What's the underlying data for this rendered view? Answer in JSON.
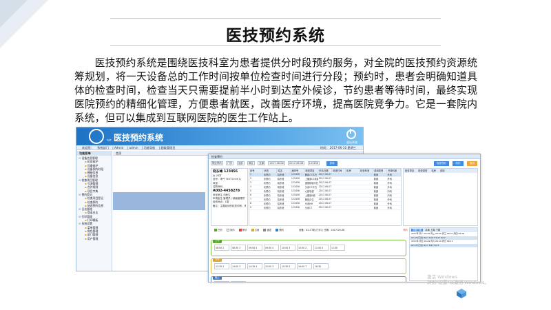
{
  "slide": {
    "title": "医技预约系统",
    "intro": "医技预约系统是围绕医技科室为患者提供分时段预约服务，对全院的医技预约资源统筹规划，将一天设备总的工作时间按单位检查时间进行分段；预约时，患者会明确知道具体的检查时间，检查当天只需要提前半小时到达室外候诊，节约患者等待时间，最终实现医院预约的精细化管理，方便患者就医，改善医疗环境，提高医院竞争力。它是一套院内系统，但可以集成到互联网医院的医生工作站上。"
  },
  "app_window": {
    "title": "医技预约系统",
    "logo_sub": "hdt",
    "exit_label": "退出系统",
    "status_bar": [
      "欢迎您：",
      "系统部门",
      "| Admin",
      "| admin",
      "| 功能导航",
      "| 超级管理员"
    ],
    "time": "时间： 2017-06-10 星期三",
    "sidebar_title": "功能菜单",
    "tab_label": "首页",
    "tree": [
      {
        "type": "grp",
        "label": "设备信息管理"
      },
      {
        "type": "sub",
        "label": "机房维护"
      },
      {
        "type": "sub",
        "label": "设备维护"
      },
      {
        "type": "sub",
        "label": "设备预约时段"
      },
      {
        "type": "sub",
        "label": "模板信息"
      },
      {
        "type": "sub",
        "label": "设备信息"
      },
      {
        "type": "grp",
        "label": "检查项目管理"
      },
      {
        "type": "sub",
        "label": "号源管理"
      },
      {
        "type": "sub",
        "label": "合并规则"
      },
      {
        "type": "sub",
        "label": "项目字典"
      },
      {
        "type": "grp",
        "label": "预约登记"
      },
      {
        "type": "sub",
        "label": "检查项目登记"
      },
      {
        "type": "sub",
        "label": "检查预约"
      },
      {
        "type": "sub",
        "label": "修改预约信息"
      },
      {
        "type": "grp",
        "label": "日志管理"
      },
      {
        "type": "sub",
        "label": "登录日志"
      },
      {
        "type": "grp",
        "label": "打印管理"
      },
      {
        "type": "sub",
        "label": "打印模板"
      },
      {
        "type": "grp",
        "label": "系统设置"
      },
      {
        "type": "sub",
        "label": "菜单管理"
      },
      {
        "type": "sub",
        "label": "角色管理"
      },
      {
        "type": "sub",
        "label": "部门管理"
      },
      {
        "type": "sub",
        "label": "用户管理"
      }
    ]
  },
  "booking_window": {
    "title": "检查预约",
    "toolbar": {
      "field1": "院区预约",
      "field2": "门诊",
      "field3": "全部",
      "field4": "病区",
      "field5": "全部",
      "date_from": "2017-06-08",
      "date_to": "2017-06-08",
      "query_value": "123456",
      "search_btn": "查询",
      "btn_check": "检查预约",
      "btn_modify": "改约",
      "btn_cancel": "取消"
    },
    "patient": {
      "name": "晓东峰 123456",
      "sex": "女 28岁",
      "sub": "挂号：李丹 TEST2019(1)",
      "dept_lbl": "科室：",
      "card_lbl": "住院号码",
      "card": "A002-4458278",
      "l1": "科室医生 刘医生",
      "l2": "申请医生 管理员 / 超级管理员",
      "l3": "检查地点：1楼",
      "l4": "备注：主要症状的检查诊断，请到门诊医疗检查室候诊"
    },
    "table_headers": [
      "序号",
      "状态",
      "姓名",
      "病历号",
      "检查项目",
      "申请日期",
      "检查时间",
      "机房",
      "检查科室",
      "费用类别",
      "开单科室"
    ],
    "rows": [
      [
        "1",
        "未预约",
        "晓东峰",
        "123456",
        "胸部CT平扫",
        "2017-06-07 15:46",
        "",
        "",
        "",
        "普通",
        "外科"
      ],
      [
        "2",
        "未预约",
        "晓东峰",
        "123456",
        "上腹部CT增强",
        "2017-06-07 15:46",
        "",
        "",
        "",
        "普通",
        "外科"
      ],
      [
        "3",
        "未预约",
        "晓东峰",
        "123456",
        "颈椎核磁平扫",
        "2017-06-07 15:46",
        "",
        "",
        "",
        "普通",
        "外科"
      ],
      [
        "4",
        "未预约",
        "晓东峰",
        "123456",
        "头颅CT平扫",
        "2017-06-07 15:46",
        "",
        "",
        "",
        "普通",
        "外科"
      ],
      [
        "5",
        "未预约",
        "晓东峰",
        "123456",
        "心脏彩超",
        "2017-06-07 15:46",
        "",
        "",
        "",
        "普通",
        "内科"
      ],
      [
        "6",
        "未预约",
        "晓东峰",
        "123456",
        "上腹部B超",
        "2017-06-07 15:46",
        "",
        "",
        "",
        "普通",
        "内科"
      ],
      [
        "7",
        "未预约",
        "晓东峰",
        "123456",
        "胸部正位",
        "2017-06-07 15:46",
        "",
        "",
        "",
        "普通",
        "外科"
      ],
      [
        "8",
        "未预约",
        "晓东峰",
        "123456",
        "头颅MR",
        "2017-06-07 15:46",
        "",
        "",
        "",
        "普通",
        "外科"
      ],
      [
        "9",
        "未预约",
        "晓东峰",
        "123456",
        "头颅CT",
        "2017-06-07 15:46",
        "",
        "",
        "",
        "普通",
        "外科"
      ]
    ],
    "right_headers": [
      "检查项目",
      "检查类型",
      "机房",
      "费用"
    ],
    "slot_legend": [
      "已约",
      "未约",
      "停诊",
      "占用",
      "锁定",
      "预约"
    ],
    "slot_title": "设备：02-CT机(门诊) | 日期：2017-06-08",
    "slot_btn": "预约",
    "am_label": "上午",
    "pm_label": "下午",
    "ev_label": "晚上",
    "am_slots": [
      "08:00 2",
      "08:30 3",
      "09:00 4",
      "09:30 4",
      "10:00 3",
      "10:30 2",
      "11:00 0",
      "11:30"
    ],
    "pm_slots": [
      "13:30 2",
      "14:00 3",
      "14:30 4",
      "15:00 3",
      "15:30 0",
      "16:00 7",
      "16:30"
    ],
    "ev_slots": [
      "18:00 2",
      "18:30"
    ],
    "side_tabs": [
      "设备日期",
      "本周",
      "上周",
      "下周"
    ],
    "side_rows": [
      "2017年  周一 06-05  周二 06-06  周三 06-07  周四 06-08",
      "02-CT(门诊)   8/17   10/17   5/17   6/17",
      "2017年  周五 06-09  周六 06-10  周日 06-11",
      "02-CT(门诊)   8/17   8/17   8/17"
    ]
  },
  "watermark": {
    "line1": "激活 Windows",
    "line2": "转到“设置”以激活 Windows。"
  }
}
